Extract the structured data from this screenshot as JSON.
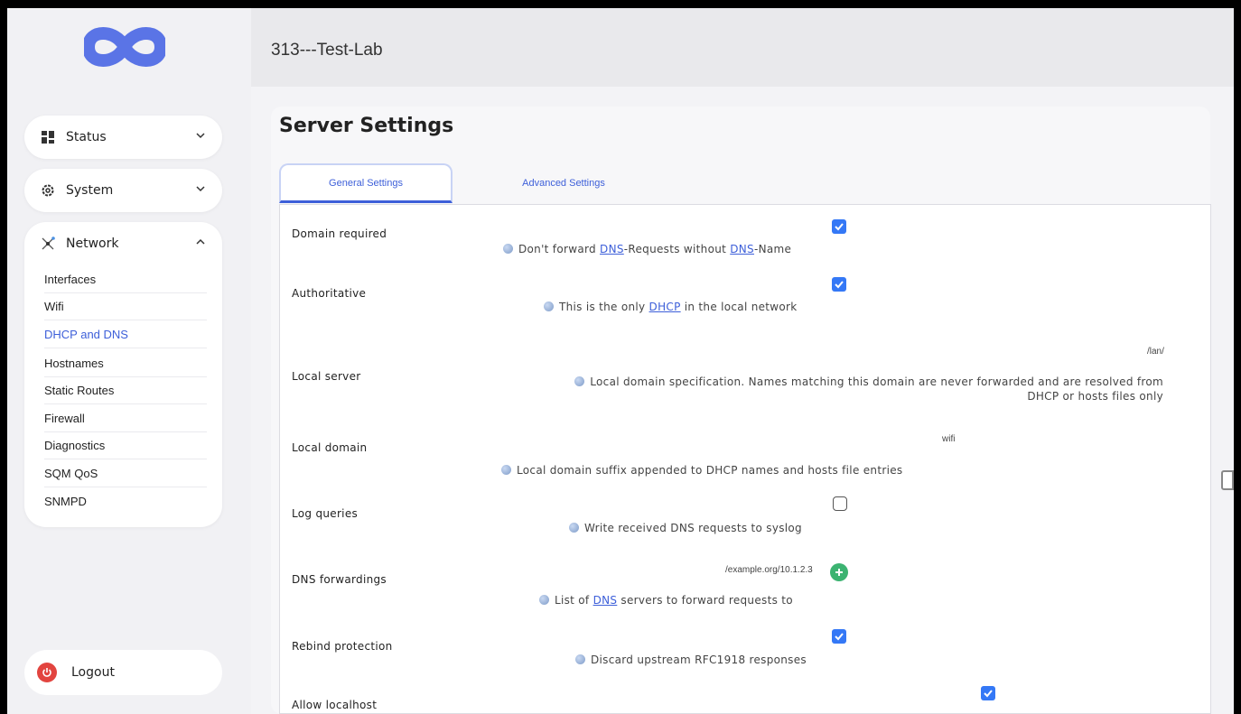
{
  "header": {
    "title": "313---Test-Lab"
  },
  "sidebar": {
    "sections": [
      {
        "label": "Status",
        "icon": "dashboard-icon",
        "expanded": false
      },
      {
        "label": "System",
        "icon": "gear-icon",
        "expanded": false
      },
      {
        "label": "Network",
        "icon": "network-icon",
        "expanded": true
      }
    ],
    "network_items": [
      {
        "label": "Interfaces",
        "active": false
      },
      {
        "label": "Wifi",
        "active": false
      },
      {
        "label": "DHCP and DNS",
        "active": true
      },
      {
        "label": "Hostnames",
        "active": false
      },
      {
        "label": "Static Routes",
        "active": false
      },
      {
        "label": "Firewall",
        "active": false
      },
      {
        "label": "Diagnostics",
        "active": false
      },
      {
        "label": "SQM QoS",
        "active": false
      },
      {
        "label": "SNMPD",
        "active": false
      }
    ],
    "logout_label": "Logout"
  },
  "main": {
    "title": "Server Settings",
    "tabs": [
      {
        "label": "General Settings",
        "active": true
      },
      {
        "label": "Advanced Settings",
        "active": false
      }
    ]
  },
  "settings": {
    "domain_required": {
      "label": "Domain required",
      "checked": true,
      "help_pre": "Don't forward ",
      "help_link1": "DNS",
      "help_mid": "-Requests without ",
      "help_link2": "DNS",
      "help_post": "-Name"
    },
    "authoritative": {
      "label": "Authoritative",
      "checked": true,
      "help_pre": "This is the only ",
      "help_link": "DHCP",
      "help_post": " in the local network"
    },
    "local_server": {
      "label": "Local server",
      "value": "/lan/",
      "help_line1": "Local domain specification. Names matching this domain are never forwarded and are resolved from",
      "help_line2": "DHCP or hosts files only"
    },
    "local_domain": {
      "label": "Local domain",
      "value": "wifi",
      "help": "Local domain suffix appended to DHCP names and hosts file entries"
    },
    "log_queries": {
      "label": "Log queries",
      "checked": false,
      "help": "Write received DNS requests to syslog"
    },
    "dns_forwardings": {
      "label": "DNS forwardings",
      "value": "/example.org/10.1.2.3",
      "help_pre": "List of ",
      "help_link": "DNS",
      "help_post": " servers to forward requests to"
    },
    "rebind_protection": {
      "label": "Rebind protection",
      "checked": true,
      "help": "Discard upstream RFC1918 responses"
    },
    "allow_localhost": {
      "label": "Allow localhost",
      "checked": true
    }
  },
  "colors": {
    "accent": "#3d5fd9",
    "checkbox": "#3478f6",
    "logo": "#5a74e6",
    "logout": "#e2443f",
    "add": "#3cb371"
  }
}
